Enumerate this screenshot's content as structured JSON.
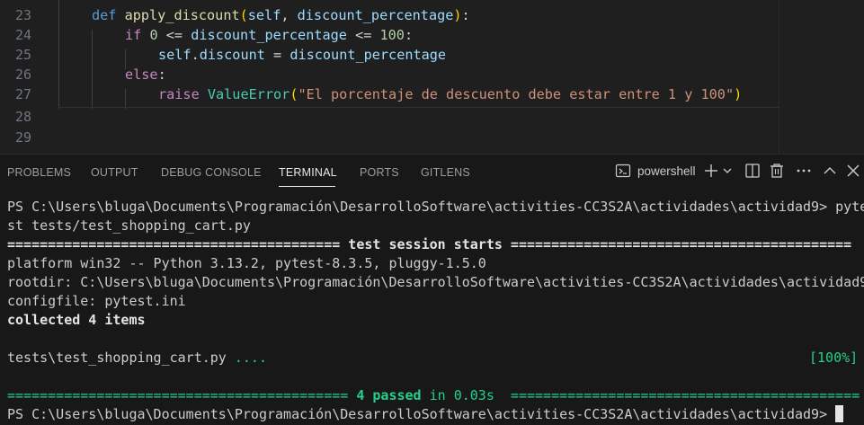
{
  "editor": {
    "line_numbers": [
      "23",
      "24",
      "25",
      "26",
      "27",
      "28",
      "29"
    ],
    "line23": {
      "kw": "def",
      "fn": "apply_discount",
      "open": "(",
      "self": "self",
      "comma": ", ",
      "param": "discount_percentage",
      "close": ")",
      "colon": ":"
    },
    "line24": {
      "kw": "if",
      "num1": "0",
      "op1": " <= ",
      "var": "discount_percentage",
      "op2": " <= ",
      "num2": "100",
      "colon": ":"
    },
    "line25": {
      "self": "self",
      "dot": ".",
      "attr": "discount",
      "op": " = ",
      "var": "discount_percentage"
    },
    "line26": {
      "kw": "else",
      "colon": ":"
    },
    "line27": {
      "kw": "raise",
      "cls": "ValueError",
      "open": "(",
      "str": "\"El porcentaje de descuento debe estar entre 1 y 100\"",
      "close": ")"
    }
  },
  "panel": {
    "tabs": [
      "PROBLEMS",
      "OUTPUT",
      "DEBUG CONSOLE",
      "TERMINAL",
      "PORTS",
      "GITLENS"
    ],
    "active_tab": "TERMINAL",
    "shell": "powershell",
    "icons": [
      "terminal-icon",
      "plus-icon",
      "chevron-down-icon",
      "split-icon",
      "trash-icon",
      "more-icon",
      "chevron-up-icon",
      "close-icon"
    ]
  },
  "terminal": {
    "lines": [
      "PS C:\\Users\\bluga\\Documents\\Programación\\DesarrolloSoftware\\activities-CC3S2A\\actividades\\actividad9> pyte",
      "st tests/test_shopping_cart.py",
      "========================================= test session starts ==========================================",
      "platform win32 -- Python 3.13.2, pytest-8.3.5, pluggy-1.5.0",
      "rootdir: C:\\Users\\bluga\\Documents\\Programación\\DesarrolloSoftware\\activities-CC3S2A\\actividades\\actividad9",
      "configfile: pytest.ini",
      "collected 4 items",
      "",
      "tests\\test_shopping_cart.py ....",
      "",
      "========================================== 4 passed in 0.03s ===========================================",
      "PS C:\\Users\\bluga\\Documents\\Programación\\DesarrolloSoftware\\activities-CC3S2A\\actividades\\actividad9> "
    ],
    "dots": "....",
    "progress": "[100%]",
    "passed": "4 passed",
    "in_time": " in 0.03s ",
    "eq_left": "========================================== ",
    "eq_right": " ===========================================",
    "session_left": "========================================= ",
    "session_label": "test session starts",
    "session_right": " =========================================="
  }
}
